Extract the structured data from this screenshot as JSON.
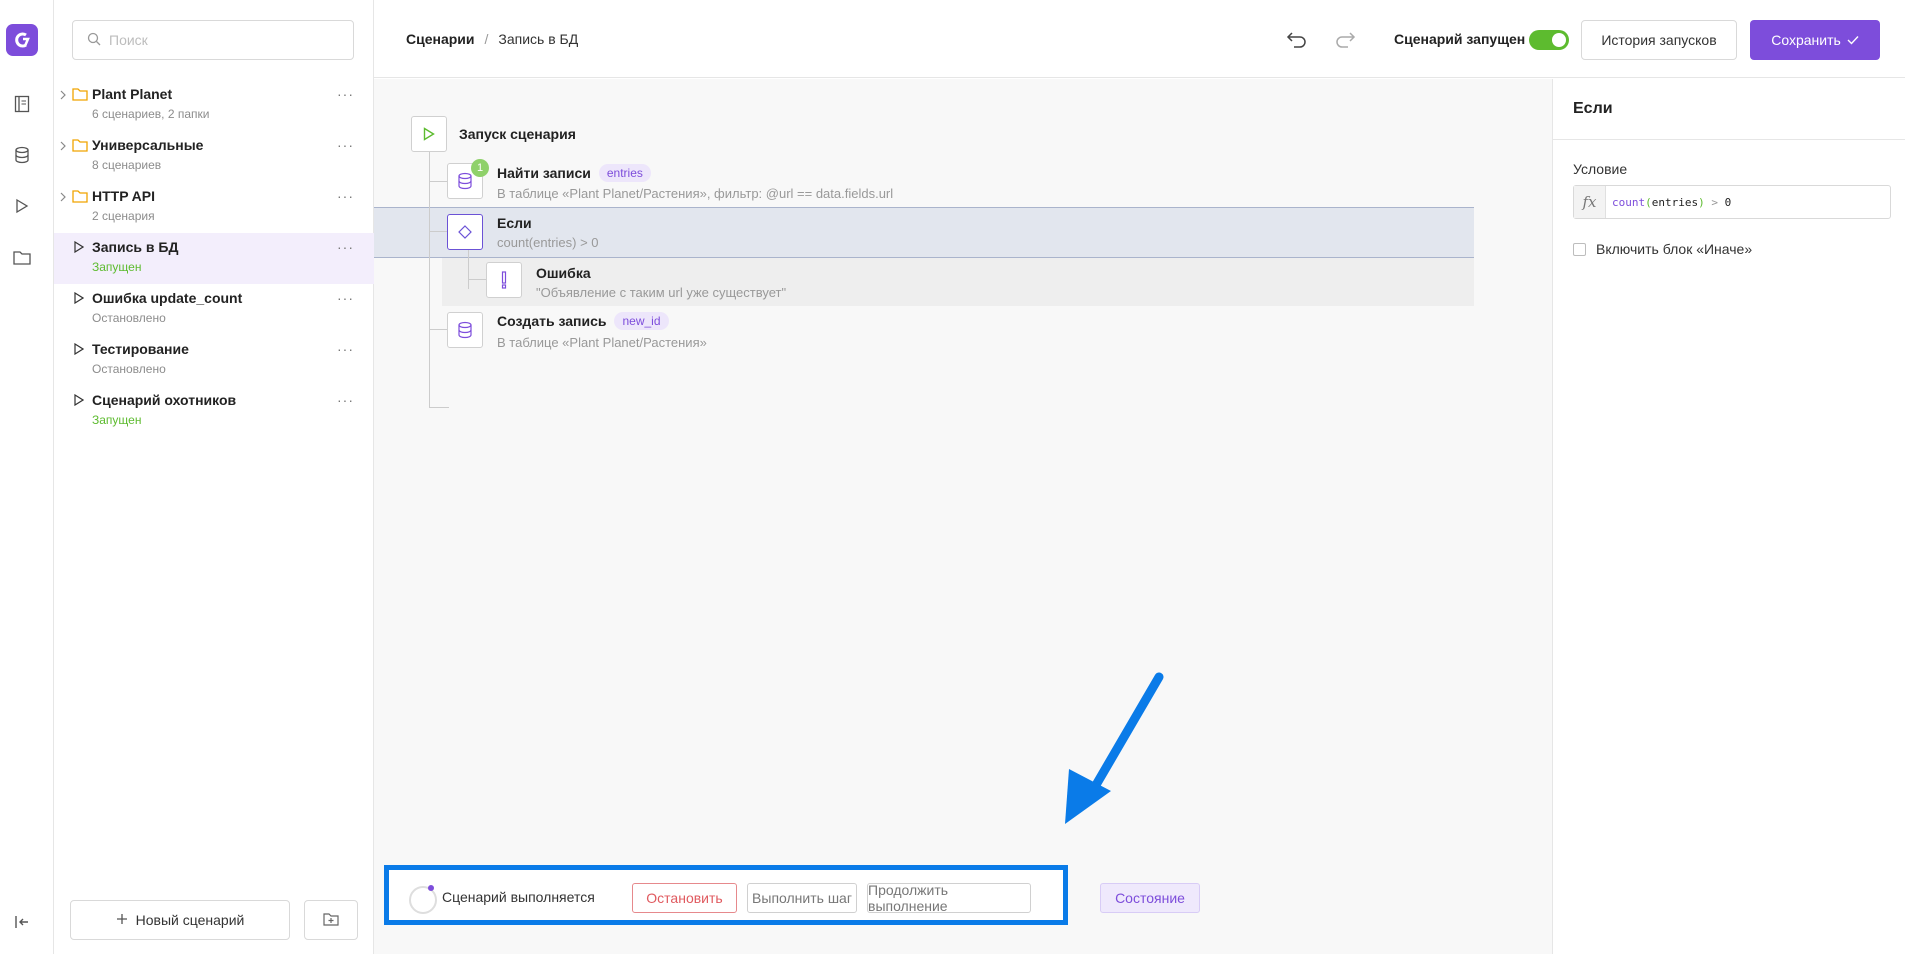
{
  "sidebar": {
    "search_placeholder": "Поиск",
    "items": [
      {
        "name": "Plant Planet",
        "sub": "6 сценариев, 2 папки",
        "type": "folder"
      },
      {
        "name": "Универсальные",
        "sub": "8 сценариев",
        "type": "folder"
      },
      {
        "name": "HTTP API",
        "sub": "2 сценария",
        "type": "folder"
      },
      {
        "name": "Запись в БД",
        "sub": "Запущен",
        "type": "scenario",
        "status": "running",
        "active": true
      },
      {
        "name": "Ошибка update_count",
        "sub": "Остановлено",
        "type": "scenario",
        "status": "stopped"
      },
      {
        "name": "Тестирование",
        "sub": "Остановлено",
        "type": "scenario",
        "status": "stopped"
      },
      {
        "name": "Сценарий охотников",
        "sub": "Запущен",
        "type": "scenario",
        "status": "running"
      }
    ],
    "more_label": "···",
    "new_scenario_label": "Новый сценарий"
  },
  "topbar": {
    "breadcrumb_root": "Сценарии",
    "breadcrumb_sep": "/",
    "breadcrumb_current": "Запись в БД",
    "running_label": "Сценарий запущен",
    "running": true,
    "history_label": "История запусков",
    "save_label": "Сохранить"
  },
  "flow": {
    "start_label": "Запуск сценария",
    "steps": [
      {
        "title": "Найти записи",
        "tag": "entries",
        "desc": "В таблице «Plant Planet/Растения», фильтр: @url == data.fields.url",
        "badge": "1"
      },
      {
        "title": "Если",
        "desc": "count(entries) > 0"
      },
      {
        "title": "Ошибка",
        "desc": "\"Объявление с таким url уже существует\""
      },
      {
        "title": "Создать запись",
        "tag": "new_id",
        "desc": "В таблице «Plant Planet/Растения»"
      }
    ]
  },
  "debugbar": {
    "status_label": "Сценарий выполняется",
    "stop_label": "Остановить",
    "step_label": "Выполнить шаг",
    "continue_label": "Продолжить выполнение",
    "state_label": "Состояние"
  },
  "panel": {
    "title": "Если",
    "condition_label": "Условие",
    "fx_label": "fx",
    "formula_fn": "count",
    "formula_arg": "entries",
    "formula_op": ">",
    "formula_val": "0",
    "else_label": "Включить блок «Иначе»"
  },
  "colors": {
    "accent": "#7d4ddb",
    "running": "#5dbb2f",
    "highlight": "#0a7be8",
    "stop": "#e05a5f"
  }
}
